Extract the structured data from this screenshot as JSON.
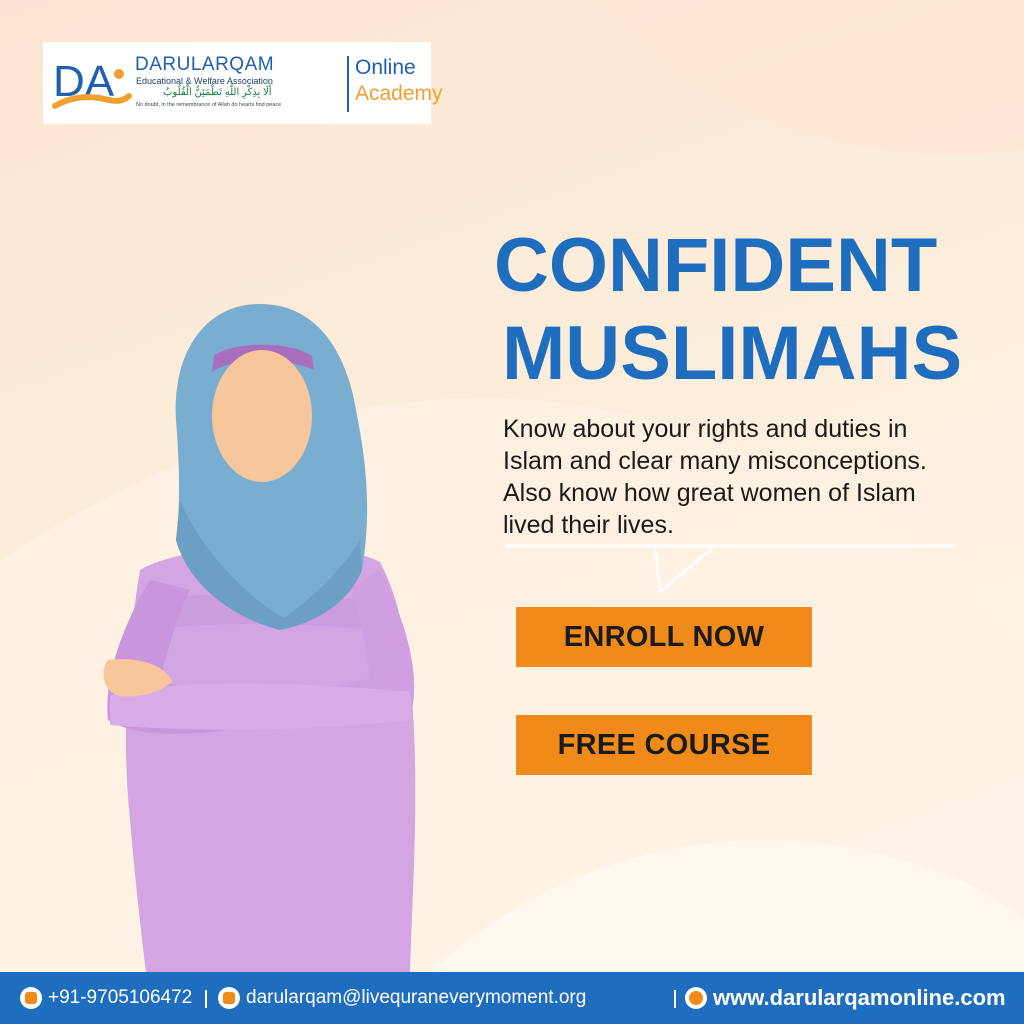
{
  "logo": {
    "mark": "DA",
    "org_name": "DARULARQAM",
    "org_tagline": "Educational & Welfare Association",
    "arabic_verse": "أَلَا بِذِكْرِ اللَّهِ تَطْمَئِنُّ الْقُلُوبُ",
    "translation": "No doubt, in the remembrance of Allah do hearts find peace",
    "online": "Online",
    "academy": "Academy"
  },
  "headline": {
    "line1": "CONFIDENT",
    "line2": "MUSLIMAHS"
  },
  "description": {
    "line1": "Know about your rights and duties in",
    "line2": "Islam and clear many misconceptions.",
    "line3": "Also know how great women of Islam",
    "line4": "lived their lives."
  },
  "buttons": {
    "enroll": "ENROLL NOW",
    "free": "FREE COURSE"
  },
  "footer": {
    "phone": "+91-9705106472",
    "email": "darularqam@livequraneverymoment.org",
    "website": "www.darularqamonline.com"
  },
  "icons": {
    "phone": "phone-icon",
    "email": "email-icon",
    "web": "globe-icon"
  },
  "colors": {
    "brand_blue": "#1f6dbf",
    "button_orange": "#f08a18",
    "academy_orange": "#f0a030",
    "hijab_blue": "#7aaed0",
    "dress_purple": "#d3a6e3"
  }
}
